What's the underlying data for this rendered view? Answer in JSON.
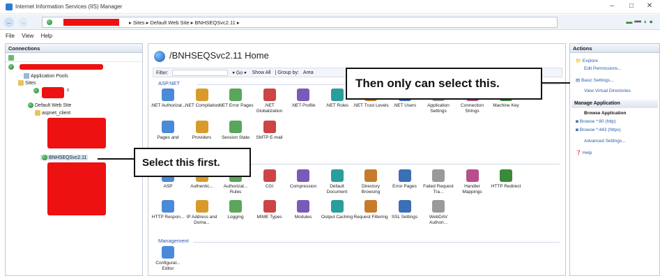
{
  "window": {
    "title": "Internet Information Services (IIS) Manager"
  },
  "address": {
    "path": "▸ Sites ▸ Default Web Site ▸ BNHSEQSvc2.11 ▸"
  },
  "menu": [
    "File",
    "View",
    "Help"
  ],
  "connections": {
    "header": "Connections",
    "tree": {
      "app_pools": "Application Pools",
      "sites": "Sites",
      "default_site": "Default Web Site",
      "aspnet_client": "aspnet_client",
      "selected": "BNHSEQSvc2.11",
      "trunc": "c"
    }
  },
  "home": {
    "title": "/BNHSEQSvc2.11 Home"
  },
  "filterbar": {
    "label": "Filter:",
    "go": "▾ Go ▾",
    "show_all": "Show All",
    "group_by": "| Group by:",
    "group_value": "Area"
  },
  "sections": {
    "aspnet": "ASP.NET",
    "management": "Management"
  },
  "aspnet_icons": [
    ".NET Authorizat...",
    ".NET Compilation",
    ".NET Error Pages",
    ".NET Globalization",
    ".NET Profile",
    ".NET Roles",
    ".NET Trust Levels",
    ".NET Users",
    "Application Settings",
    "Connection Strings",
    "Machine Key"
  ],
  "aspnet_icons2": [
    "Pages and",
    "Providers",
    "Session State",
    "SMTP E-mail"
  ],
  "iis_icons": [
    "ASP",
    "Authentic...",
    "Authorizat... Rules",
    "CGI",
    "Compression",
    "Default Document",
    "Directory Browsing",
    "Error Pages",
    "Failed Request Tra...",
    "Handler Mappings",
    "HTTP Redirect"
  ],
  "iis_icons2": [
    "HTTP Respon...",
    "IP Address and Doma...",
    "Logging",
    "MIME Types",
    "Modules",
    "Output Caching",
    "Request Filtering",
    "SSL Settings",
    "WebDAV Authori..."
  ],
  "mgmt_icons": [
    "Configurat... Editor"
  ],
  "actions": {
    "header": "Actions",
    "explore": "Explore",
    "edit_permissions": "Edit Permissions...",
    "basic_settings": "Basic Settings...",
    "view_vdirs": "View Virtual Directories",
    "manage_app": "Manage Application",
    "browse_app": "Browse Application",
    "browse80": "Browse *:80 (http)",
    "browse443": "Browse *:443 (https)",
    "advanced": "Advanced Settings...",
    "help": "Help"
  },
  "callouts": {
    "first": "Select this first.",
    "then": "Then only can select this."
  },
  "colors": {
    "redaction": "#ee1111",
    "link": "#2a5caa"
  }
}
